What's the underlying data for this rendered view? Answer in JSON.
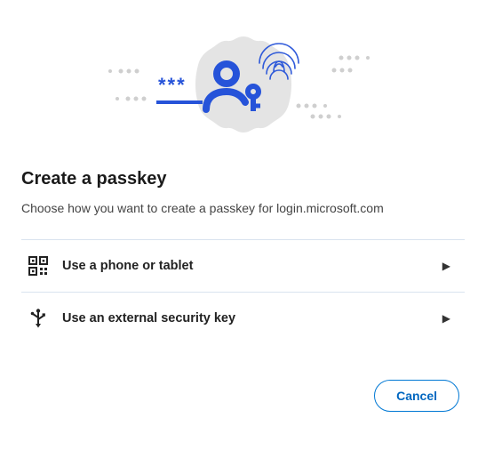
{
  "dialog": {
    "title": "Create a passkey",
    "subtitle": "Choose how you want to create a passkey for login.microsoft.com"
  },
  "options": {
    "phone": {
      "label": "Use a phone or tablet"
    },
    "key": {
      "label": "Use an external security key"
    }
  },
  "footer": {
    "cancel_label": "Cancel"
  },
  "colors": {
    "accent_blue": "#2653d9",
    "light_grey": "#d7d7d7",
    "button_blue": "#0067c0"
  }
}
